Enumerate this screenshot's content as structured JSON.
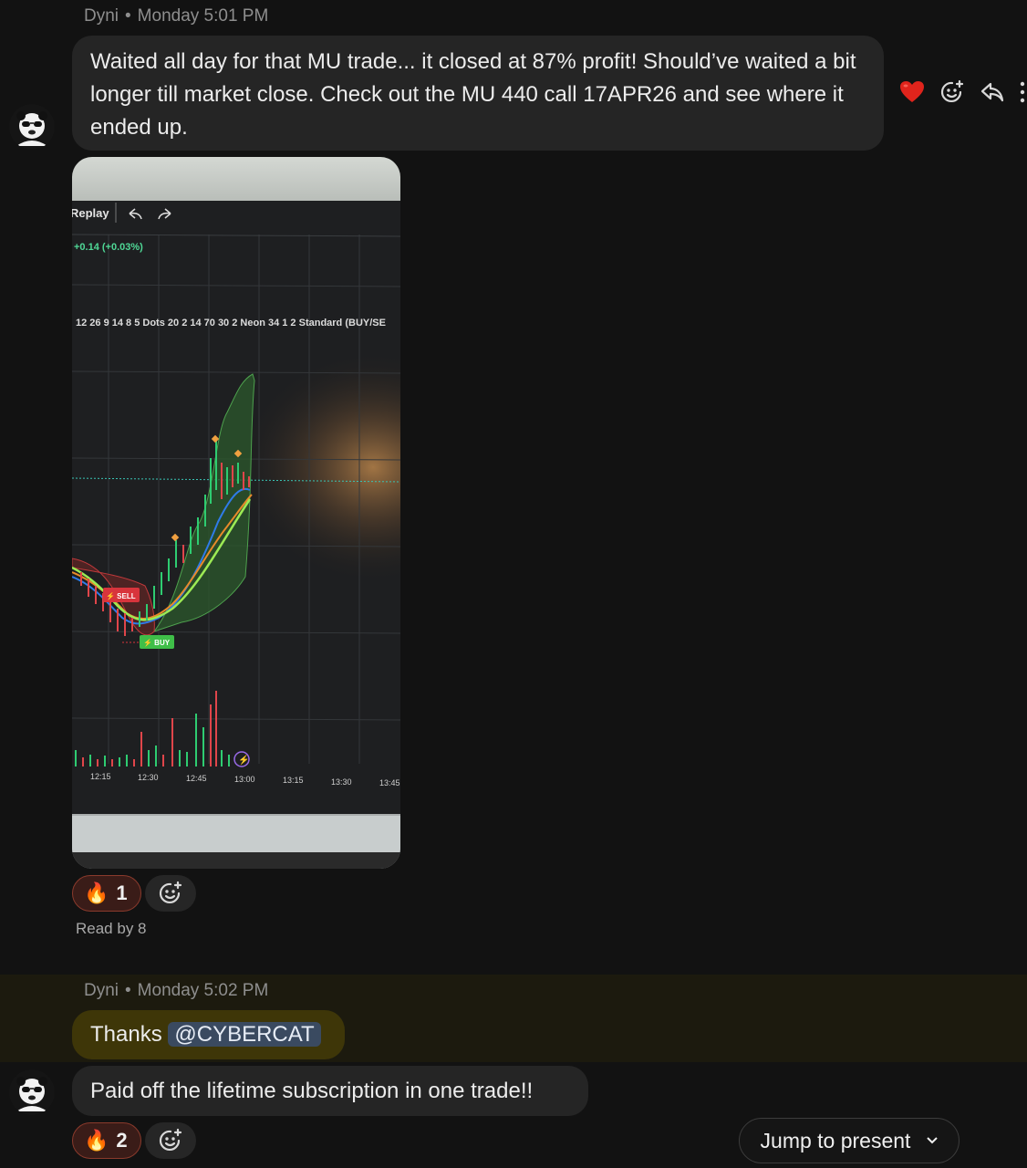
{
  "messages": [
    {
      "author": "Dyni",
      "separator": "•",
      "time": "Monday 5:01 PM",
      "text": "Waited all day for that MU trade... it closed at 87% profit! Should’ve waited a bit longer till market close. Check out the MU 440 call 17APR26 and see where it ended up.",
      "image": {
        "toolbar_label": "Replay",
        "change_text": "+0.14 (+0.03%)",
        "indicator_text": "12 26 9 14 8 5 Dots 20 2 14 70 30 2 Neon 34 1 2 Standard (BUY/SE",
        "sell_label": "⚡ SELL",
        "buy_label": "⚡ BUY",
        "time_labels": [
          "12:15",
          "12:30",
          "12:45",
          "13:00",
          "13:15",
          "13:30",
          "13:45"
        ]
      },
      "reactions": [
        {
          "emoji": "🔥",
          "count": "1"
        }
      ],
      "read_receipt": "Read by 8",
      "hover_actions": [
        "heart-icon",
        "add-reaction-icon",
        "reply-icon",
        "more-icon"
      ]
    },
    {
      "author": "Dyni",
      "separator": "•",
      "time": "Monday 5:02 PM",
      "text_prefix": "Thanks",
      "mention": "@CYBERCAT",
      "highlight_color": "#3e3608"
    },
    {
      "text": "Paid off the lifetime subscription in one trade!!",
      "reactions": [
        {
          "emoji": "🔥",
          "count": "2"
        }
      ]
    }
  ],
  "jump_button": {
    "label": "Jump to present"
  },
  "colors": {
    "background": "#121212",
    "bubble": "#252525",
    "mention": "#3a4a60"
  }
}
